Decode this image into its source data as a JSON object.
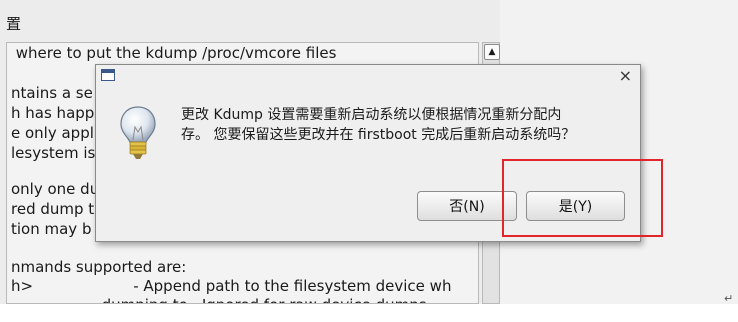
{
  "background": {
    "title_fragment": "置",
    "lines": [
      " where to put the kdump /proc/vmcore files",
      "",
      "ntains a se",
      "h has happ",
      "e only appli",
      "lesystem is",
      "",
      "only one du",
      "red dump t",
      "tion may b",
      "",
      "nmands supported are:",
      "h>                     - Append path to the filesystem device wh",
      "                   dumping to.  Ignored for raw device dumps."
    ]
  },
  "dialog": {
    "message_line1": "更改 Kdump 设置需要重新启动系统以便根据情况重新分配内",
    "message_line2": "存。 您要保留这些更改并在 firstboot 完成后重新启动系统吗？",
    "no_label": "否(N)",
    "yes_label": "是(Y)",
    "close_glyph": "×",
    "icon": "lightbulb-icon"
  },
  "page": {
    "paragraph_mark": "↵"
  },
  "colors": {
    "highlight": "#e0262b"
  }
}
